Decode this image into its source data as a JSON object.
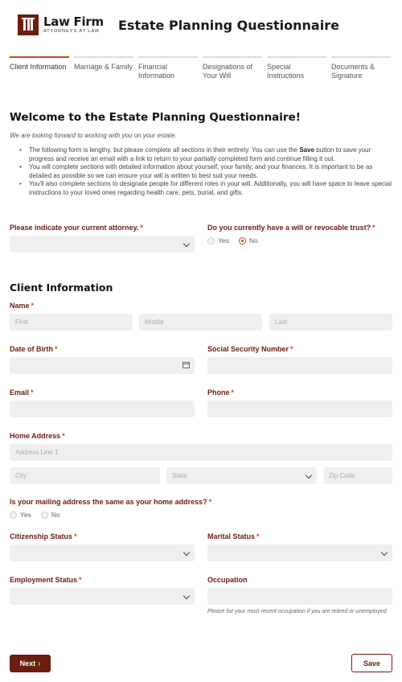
{
  "header": {
    "logo_name": "Law Firm",
    "logo_tagline": "ATTORNEYS AT LAW",
    "title": "Estate Planning Questionnaire"
  },
  "steps": [
    {
      "label": "Client Information",
      "active": true
    },
    {
      "label": "Marriage & Family",
      "active": false
    },
    {
      "label": "Financial Information",
      "active": false
    },
    {
      "label": "Designations of Your Will",
      "active": false
    },
    {
      "label": "Special Instructions",
      "active": false
    },
    {
      "label": "Documents & Signature",
      "active": false
    }
  ],
  "welcome": {
    "title": "Welcome to the Estate Planning Questionnaire!",
    "intro": "We are looking forward to working with you on your estate.",
    "bullet1_before": "The following form is lengthy, but please complete all sections in their entirety. You can use the ",
    "bullet1_bold": "Save",
    "bullet1_after": " button to save your progress and receive an email with a link to return to your partially completed form and continue filling it out.",
    "bullet2": "You will complete sections with detailed information about yourself, your family, and your finances. It is important to be as detailed as possible so we can ensure your will is written to best suit your needs.",
    "bullet3": "You'll also complete sections to designate people for different roles in your will. Additionally, you will have space to leave special instructions to your loved ones regarding health care, pets, burial, and gifts."
  },
  "required_marker": "*",
  "attorney": {
    "label": "Please indicate your current attorney.",
    "value": ""
  },
  "trust": {
    "label": "Do you currently have a will or revocable trust?",
    "options": [
      "Yes",
      "No"
    ],
    "selected": "No"
  },
  "client_section": {
    "title": "Client Information",
    "name": {
      "label": "Name",
      "first_placeholder": "First",
      "middle_placeholder": "Middle",
      "last_placeholder": "Last"
    },
    "dob": {
      "label": "Date of Birth",
      "value": ""
    },
    "ssn": {
      "label": "Social Security Number",
      "value": ""
    },
    "email": {
      "label": "Email",
      "value": ""
    },
    "phone": {
      "label": "Phone",
      "value": ""
    },
    "address": {
      "label": "Home Address",
      "line1_placeholder": "Address Line 1",
      "city_placeholder": "City",
      "state_placeholder": "State",
      "zip_placeholder": "Zip Code"
    },
    "mailing_same": {
      "label": "Is your mailing address the same as your home address?",
      "options": [
        "Yes",
        "No"
      ],
      "selected": ""
    },
    "citizenship": {
      "label": "Citizenship Status",
      "value": ""
    },
    "marital": {
      "label": "Marital Status",
      "value": ""
    },
    "employment": {
      "label": "Employment Status",
      "value": ""
    },
    "occupation": {
      "label": "Occupation",
      "value": "",
      "hint": "Please list your most recent occupation if you are retired or unemployed."
    }
  },
  "buttons": {
    "next": "Next",
    "save": "Save"
  },
  "colors": {
    "brand": "#6b1d0e",
    "accent": "#c64a1f",
    "field_bg": "#efefef"
  }
}
